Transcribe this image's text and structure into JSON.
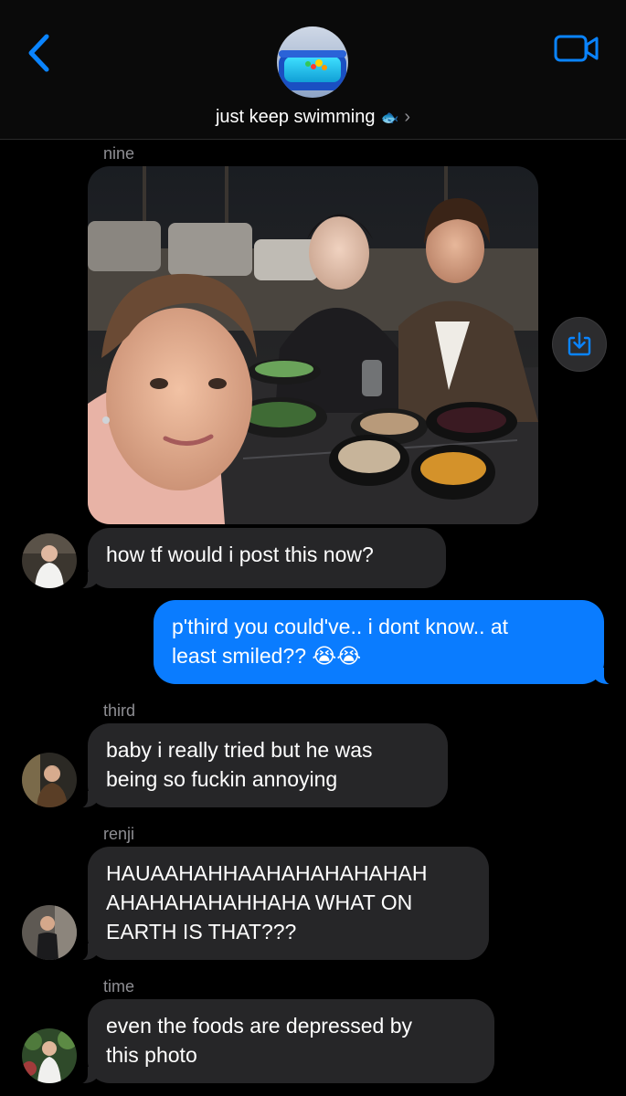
{
  "header": {
    "group_name": "just keep swimming",
    "group_emoji": "🐟",
    "chevron": "›",
    "accent_color": "#0a84ff",
    "icons": {
      "back": "chevron-left-icon",
      "video": "video-camera-icon",
      "avatar": "pool-photo"
    }
  },
  "messages": [
    {
      "sender": "nine",
      "type": "photo",
      "save_icon": "save-to-photos-icon"
    },
    {
      "type": "text",
      "direction": "incoming",
      "text": "how tf would i post this now?"
    },
    {
      "type": "text",
      "direction": "outgoing",
      "line1": "p'third you could've.. i dont know.. at",
      "line2": "least smiled?? 😭😭"
    },
    {
      "sender": "third",
      "type": "text",
      "direction": "incoming",
      "line1": "baby i really tried but he was",
      "line2": "being so fuckin annoying"
    },
    {
      "sender": "renji",
      "type": "text",
      "direction": "incoming",
      "line1": "HAUAAHAHHAAHAHAHAHAHAH",
      "line2": "AHAHAHAHAHHAHA WHAT ON",
      "line3": "EARTH IS THAT???"
    },
    {
      "sender": "time",
      "type": "text",
      "direction": "incoming",
      "line1": "even the foods are depressed by",
      "line2": "this photo"
    }
  ],
  "colors": {
    "incoming_bubble": "#262628",
    "outgoing_bubble": "#0a7cff",
    "sender_label": "#8e8e93"
  }
}
